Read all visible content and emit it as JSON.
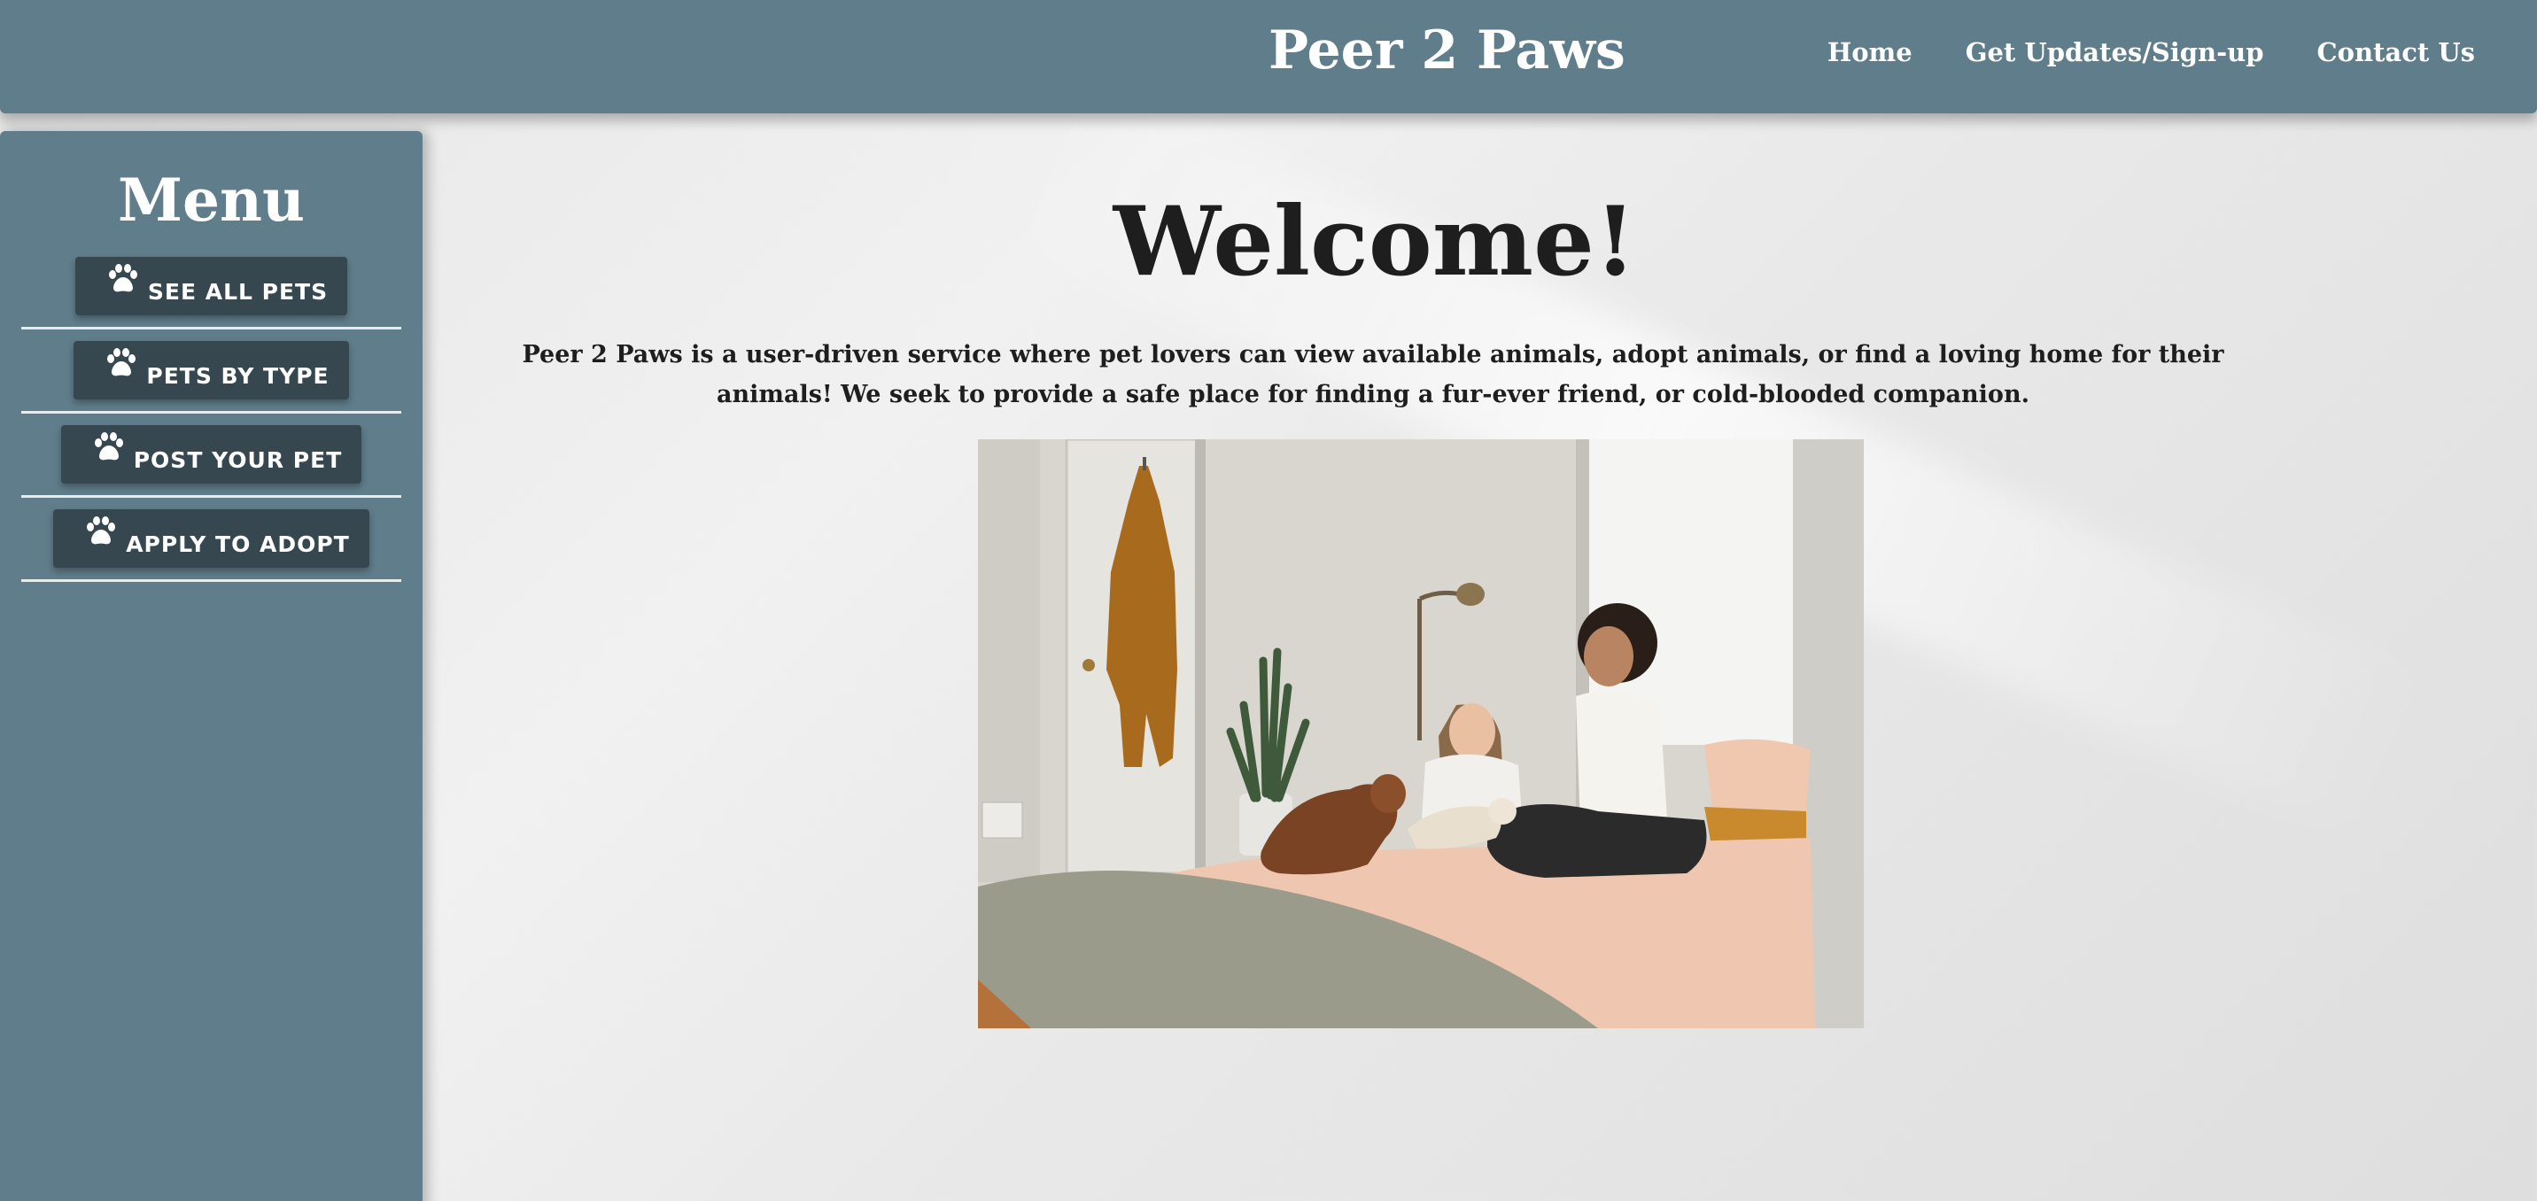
{
  "header": {
    "site_title": "Peer 2 Paws",
    "nav": [
      {
        "label": "Home"
      },
      {
        "label": "Get Updates/Sign-up"
      },
      {
        "label": "Contact Us"
      }
    ]
  },
  "sidebar": {
    "title": "Menu",
    "items": [
      {
        "label": "SEE ALL PETS",
        "icon": "paw-icon"
      },
      {
        "label": "PETS BY TYPE",
        "icon": "paw-icon"
      },
      {
        "label": "POST YOUR PET",
        "icon": "paw-icon"
      },
      {
        "label": "APPLY TO ADOPT",
        "icon": "paw-icon"
      }
    ]
  },
  "main": {
    "heading": "Welcome!",
    "intro": "Peer 2 Paws is a user-driven service where pet lovers can view available animals, adopt animals, or find a loving home for their animals! We seek to provide a safe place for finding a fur-ever friend, or cold-blooded companion."
  },
  "colors": {
    "header_bg": "#607d8b",
    "sidebar_bg": "#607d8b",
    "button_bg": "#37474f",
    "text_dark": "#1e1e1e"
  }
}
